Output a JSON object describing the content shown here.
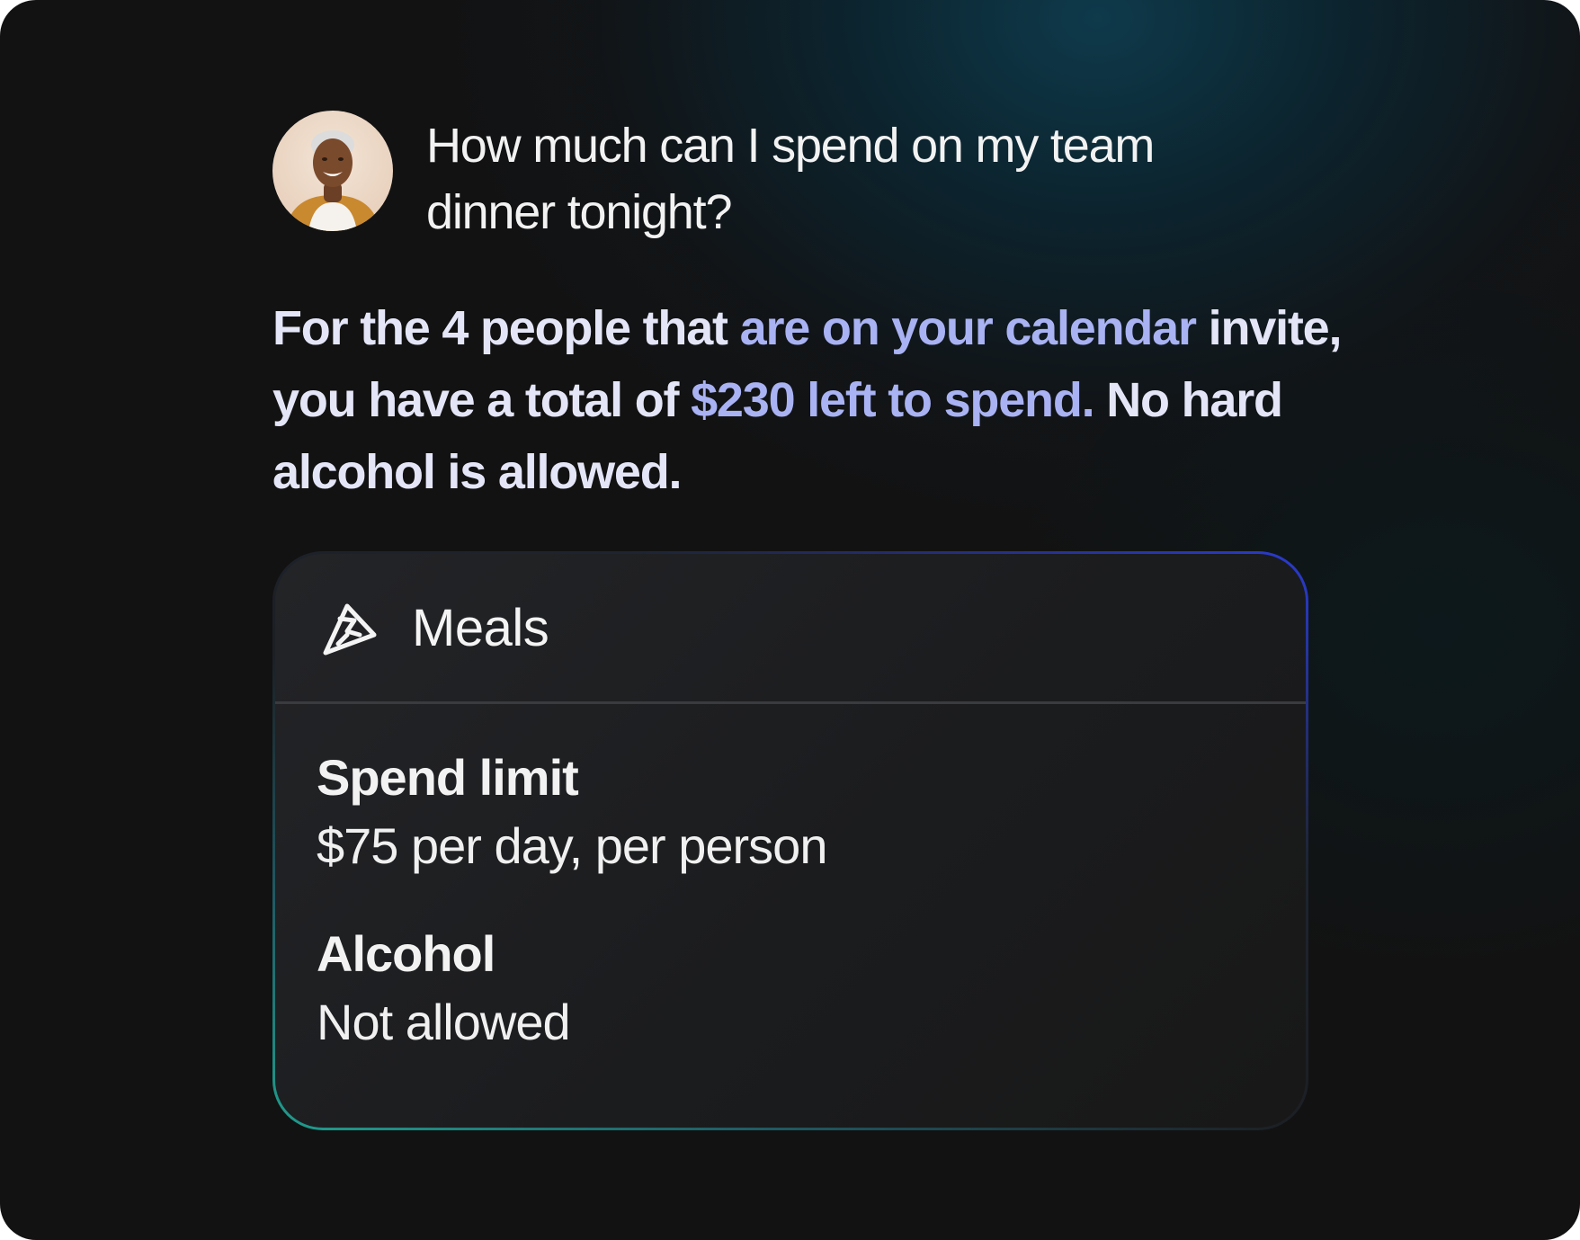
{
  "question": {
    "text": "How much can I spend on my team dinner tonight?"
  },
  "answer": {
    "part1": "For the 4 people that ",
    "part2": "are on your calendar",
    "part3": " invite, you have a total of ",
    "part4": "$230 left to spend.",
    "part5": " No hard alcohol is allowed."
  },
  "card": {
    "icon": "meals-logo-icon",
    "title": "Meals",
    "rules": [
      {
        "label": "Spend limit",
        "value": "$75 per day, per person"
      },
      {
        "label": "Alcohol",
        "value": "Not allowed"
      }
    ]
  },
  "colors": {
    "highlight": "#a9b2f2",
    "background": "#121212",
    "card_border_start": "#1f9e8e",
    "card_border_end": "#2a3bd0"
  }
}
